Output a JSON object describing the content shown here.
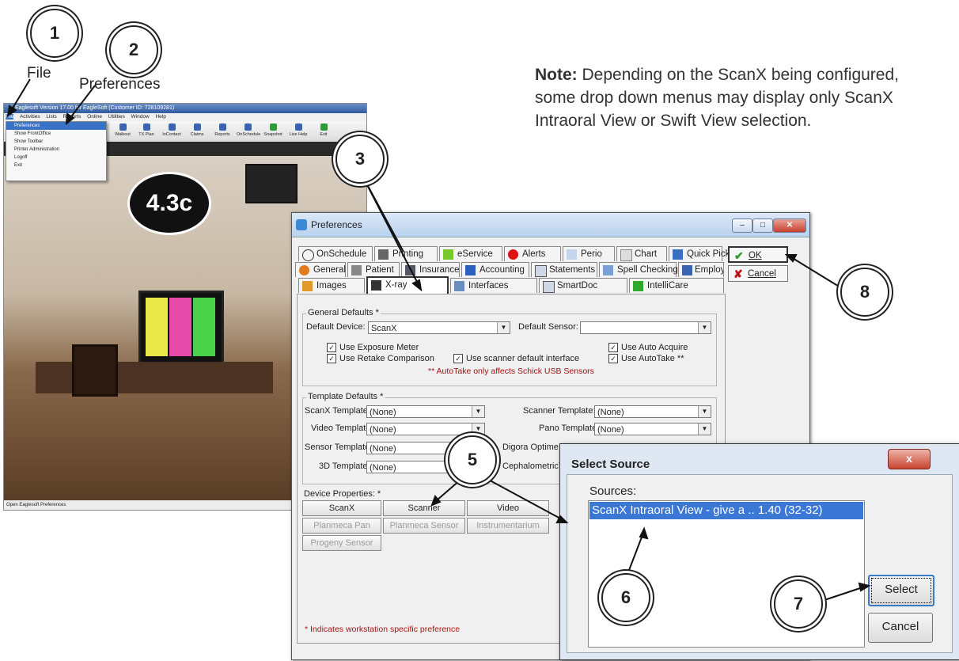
{
  "callouts": [
    "1",
    "2",
    "3",
    "5",
    "6",
    "7",
    "8"
  ],
  "labels": {
    "file": "File",
    "preferences": "Preferences"
  },
  "note": {
    "bold": "Note:",
    "text": "Depending on the ScanX being configured, some drop down menus may display only ScanX Intraoral View or Swift View selection."
  },
  "eaglesoft": {
    "title": "Eaglesoft Version 17.00 for EagleSoft (Customer ID: 728109281)",
    "menus": [
      "File",
      "Activities",
      "Lists",
      "Reports",
      "Online",
      "Utilities",
      "Window",
      "Help"
    ],
    "file_menu": [
      "Preferences",
      "Show FrontOffice",
      "Show Toolbar",
      "Printer Administration",
      "Logoff",
      "Exit"
    ],
    "toolbar": [
      "Walkout",
      "TX Plan",
      "InContact",
      "Claims",
      "Reports",
      "OnSchedule",
      "Snapshot",
      "Live Help",
      "Exit"
    ],
    "badge": "4.3c",
    "status": "Open Eaglesoft Preferences"
  },
  "prefs": {
    "title": "Preferences",
    "tabs_row1": [
      "OnSchedule",
      "Printing",
      "eService",
      "Alerts",
      "Perio",
      "Chart",
      "Quick Picks"
    ],
    "tabs_row2": [
      "General",
      "Patient",
      "Insurance",
      "Accounting",
      "Statements",
      "Spell Checking",
      "Employer"
    ],
    "tabs_row3": [
      "Images",
      "X-ray",
      "Interfaces",
      "SmartDoc",
      "IntelliCare"
    ],
    "ok": "OK",
    "cancel": "Cancel",
    "general_defaults": "General Defaults *",
    "default_device_label": "Default Device:",
    "default_device_value": "ScanX",
    "default_sensor_label": "Default Sensor:",
    "default_sensor_value": "",
    "checks": [
      "Use Exposure Meter",
      "Use Retake Comparison",
      "Use scanner default interface",
      "Use Auto Acquire",
      "Use AutoTake **"
    ],
    "autotake_note": "** AutoTake only affects Schick USB Sensors",
    "template_defaults": "Template Defaults *",
    "scanx_template_label": "ScanX Template:",
    "scanx_template": "(None)",
    "scanner_template_label": "Scanner Template:",
    "scanner_template": "(None)",
    "video_template_label": "Video Template:",
    "video_template": "(None)",
    "pano_template_label": "Pano Template:",
    "pano_template": "(None)",
    "sensor_template_label": "Sensor Template:",
    "sensor_template": "(None)",
    "digora_label": "Digora Optime Te",
    "threed_template_label": "3D Template:",
    "threed_template": "(None)",
    "ceph_label": "CephalometricTe",
    "device_properties": "Device Properties: *",
    "device_buttons": [
      "ScanX",
      "Scanner",
      "Video"
    ],
    "device_buttons_disabled": [
      "Planmeca Pan",
      "Planmeca Sensor",
      "Instrumentarium",
      "Progeny Sensor"
    ],
    "footnote": "* Indicates workstation specific preference"
  },
  "select_source": {
    "title": "Select Source",
    "close": "x",
    "sources_label": "Sources:",
    "item": "ScanX Intraoral View - give a .. 1.40 (32-32)",
    "select": "Select",
    "cancel": "Cancel"
  }
}
